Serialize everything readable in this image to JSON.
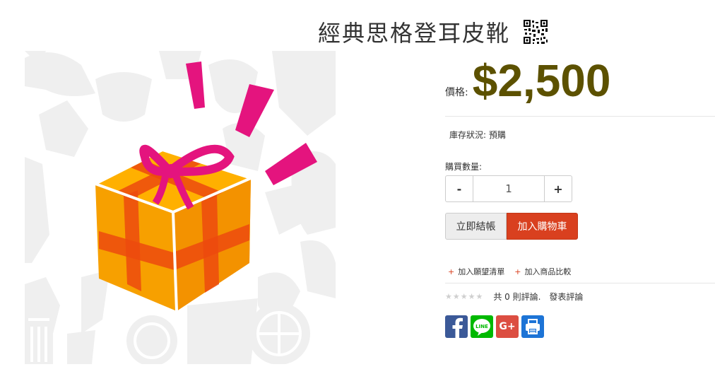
{
  "product": {
    "title": "經典思格登耳皮靴",
    "qr_icon": "qr-code-icon"
  },
  "price": {
    "label": "價格:",
    "value": "$2,500",
    "color": "#5c5100"
  },
  "stock": {
    "text": "庫存狀況: 預購"
  },
  "quantity": {
    "label": "購買數量:",
    "value": "1",
    "decrement": "-",
    "increment": "+"
  },
  "actions": {
    "buy_now": "立即結帳",
    "add_to_cart": "加入購物車",
    "cart_color": "#d9401f"
  },
  "links": {
    "wishlist": "加入願望清單",
    "compare": "加入商品比較",
    "plus": "+"
  },
  "reviews": {
    "stars": "★★★★★",
    "count_text": "共 0 則評論.",
    "write": "發表評論"
  },
  "share": {
    "facebook_icon": "facebook-icon",
    "line_icon": "line-icon",
    "line_text": "LINE",
    "googleplus_icon": "google-plus-icon",
    "googleplus_text": "G+",
    "print_icon": "print-icon"
  }
}
